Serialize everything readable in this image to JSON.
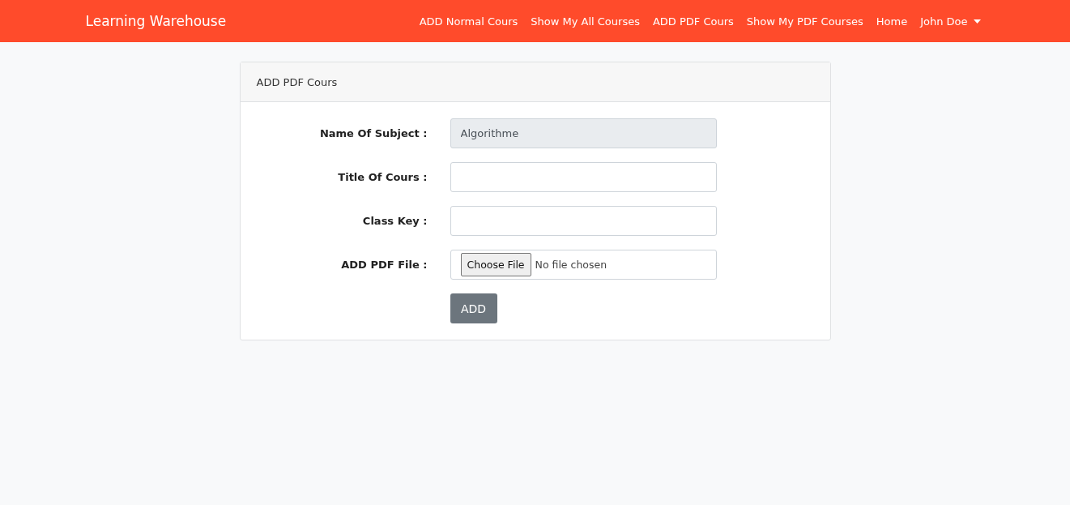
{
  "navbar": {
    "brand": "Learning Warehouse",
    "links": [
      {
        "label": "ADD Normal Cours",
        "kind": "link"
      },
      {
        "label": "Show My All Courses",
        "kind": "link"
      },
      {
        "label": "ADD PDF Cours",
        "kind": "link"
      },
      {
        "label": "Show My PDF Courses",
        "kind": "link"
      },
      {
        "label": "Home",
        "kind": "link"
      },
      {
        "label": "John Doe",
        "kind": "dropdown"
      }
    ]
  },
  "card": {
    "title": "ADD PDF Cours",
    "fields": [
      {
        "label": "Name Of Subject :",
        "kind": "text",
        "value": "Algorithme",
        "disabled": true
      },
      {
        "label": "Title Of Cours :",
        "kind": "text",
        "disabled": false
      },
      {
        "label": "Class Key :",
        "kind": "text",
        "disabled": false
      },
      {
        "label": "ADD PDF File :",
        "kind": "file",
        "button": "Choose File",
        "status": "No file chosen"
      }
    ],
    "submit": "ADD"
  }
}
